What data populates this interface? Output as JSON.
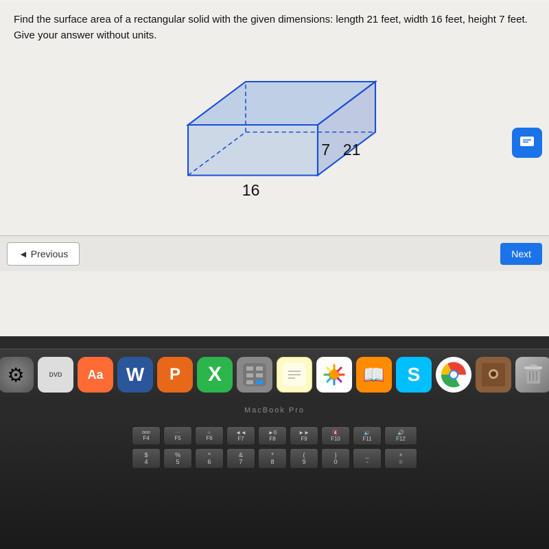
{
  "screen": {
    "question": {
      "text": "Find the surface area of a rectangular solid with the given dimensions: length 21 feet, width 16 feet, height 7 feet. Give your answer without units."
    },
    "diagram": {
      "length_label": "21",
      "width_label": "16",
      "height_label": "7"
    },
    "navigation": {
      "previous_label": "◄ Previous",
      "next_label": "Next"
    },
    "chat_icon": "≡"
  },
  "bezel": {
    "macbook_label": "MacBook Pro"
  },
  "dock": {
    "icons": [
      {
        "name": "system-preferences",
        "label": "⚙"
      },
      {
        "name": "dvd-player",
        "label": "DVD"
      },
      {
        "name": "dictionary",
        "label": "Aa"
      },
      {
        "name": "word",
        "label": "W"
      },
      {
        "name": "pages",
        "label": "P"
      },
      {
        "name": "cross-app",
        "label": "X"
      },
      {
        "name": "calculator",
        "label": "🔢"
      },
      {
        "name": "notes",
        "label": "📝"
      },
      {
        "name": "photos",
        "label": "🌸"
      },
      {
        "name": "books",
        "label": "📖"
      },
      {
        "name": "s-app",
        "label": "S"
      },
      {
        "name": "chrome",
        "label": "🌐"
      },
      {
        "name": "photo-booth",
        "label": "📷"
      },
      {
        "name": "trash",
        "label": "🗑"
      }
    ]
  },
  "keyboard": {
    "row1": [
      "ooo F4",
      "F5",
      "F6",
      "F7",
      "F8",
      "F9",
      "F10",
      "F11",
      "F12"
    ],
    "row2": [
      "$\n4",
      "%\n5",
      "^\n6",
      "&\n7",
      "*\n8",
      "(\n9",
      ")\n0",
      "-",
      "="
    ]
  }
}
